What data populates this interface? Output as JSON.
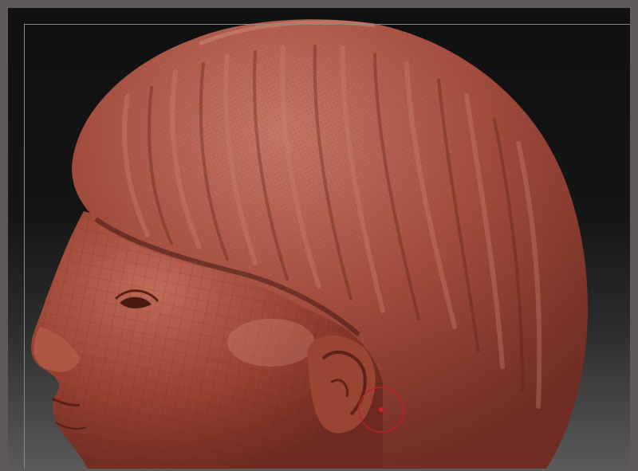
{
  "app": {
    "viewport_title": "",
    "brush_cursor": "brush-cursor-icon",
    "colors": {
      "background_top": "#101010",
      "background_bottom": "#5a5a5a",
      "clay": "#8f3b2e",
      "clay_highlight": "#c07060",
      "window_frame": "#5e5a5a",
      "brush_ring": "#c0202a"
    }
  }
}
